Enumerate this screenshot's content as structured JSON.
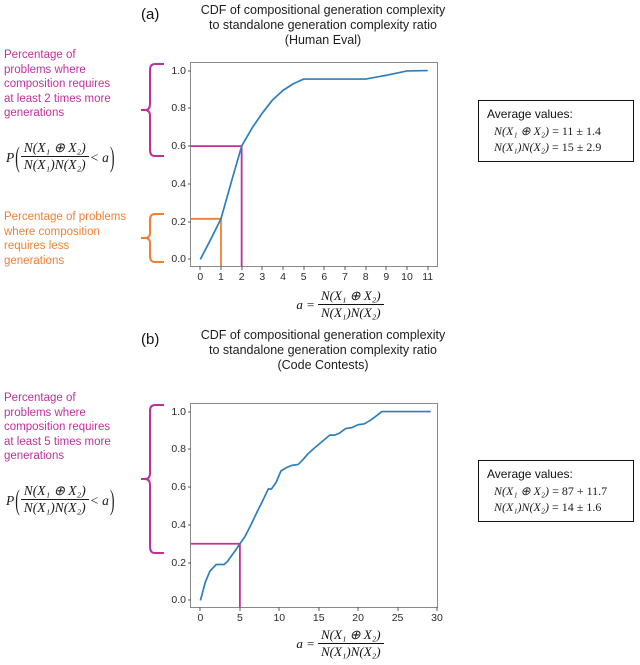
{
  "figure": {
    "panels": [
      {
        "letter": "(a)",
        "title_line1": "CDF of compositional generation complexity",
        "title_line2": "to standalone generation complexity ratio",
        "title_line3": "(Human Eval)"
      },
      {
        "letter": "(b)",
        "title_line1": "CDF of compositional generation complexity",
        "title_line2": "to standalone generation complexity ratio",
        "title_line3": "(Code Contests)"
      }
    ]
  },
  "annotations": {
    "a_purple": {
      "text": "Percentage of problems where composition requires at least 2 times more generations",
      "lines": [
        "Percentage of",
        "problems where",
        "composition requires",
        "at least 2 times more",
        "generations"
      ],
      "color": "#c0309c",
      "span_from": 0.6,
      "span_to": 1.0
    },
    "a_orange": {
      "text": "Percentage of problems where composition requires less generations",
      "lines": [
        "Percentage of problems",
        "where composition",
        "requires less",
        "generations"
      ],
      "color": "#f07f35",
      "span_from": 0.0,
      "span_to": 0.2
    },
    "b_purple": {
      "text": "Percentage of problems where composition requires at least 5 times more generations",
      "lines": [
        "Percentage of",
        "problems where",
        "composition requires",
        "at least 5 times more",
        "generations"
      ],
      "color": "#c0309c",
      "span_from": 0.3,
      "span_to": 1.0
    },
    "probability_formula": {
      "p": "P",
      "numerator": "N(X₁ ⊕ X₂)",
      "denominator": "N(X₁)N(X₂)",
      "comparison": "< a"
    },
    "axis_formula": {
      "lhs": "a =",
      "numerator": "N(X₁ ⊕ X₂)",
      "denominator": "N(X₁)N(X₂)"
    }
  },
  "info_boxes": [
    {
      "title": "Average values:",
      "rows": [
        {
          "label": "N(X₁ ⊕ X₂)",
          "value": "= 11 ± 1.4"
        },
        {
          "label": "N(X₁)N(X₂)",
          "value": "= 15 ± 2.9"
        }
      ]
    },
    {
      "title": "Average values:",
      "rows": [
        {
          "label": "N(X₁ ⊕ X₂)",
          "value": "= 87 + 11.7"
        },
        {
          "label": "N(X₁)N(X₂)",
          "value": "= 14 ± 1.6"
        }
      ]
    }
  ],
  "colors": {
    "curve": "#2e7ebb",
    "purple": "#c0309c",
    "orange": "#f07f35",
    "axis": "#8a8a8a",
    "text": "#1a1a1a"
  },
  "chart_data": [
    {
      "type": "line",
      "title": "CDF of compositional generation complexity to standalone generation complexity ratio (Human Eval)",
      "subtitle": "(Human Eval)",
      "xlabel": "a = N(X1 (+) X2) / N(X1)N(X2)",
      "ylabel": "",
      "xlim": [
        -0.45,
        11.45
      ],
      "ylim": [
        -0.035,
        1.04
      ],
      "xticks": [
        0,
        1,
        2,
        3,
        4,
        5,
        6,
        7,
        8,
        9,
        10,
        11
      ],
      "yticks": [
        0.0,
        0.2,
        0.4,
        0.6,
        0.8,
        1.0
      ],
      "grid": false,
      "legend": "none",
      "series": [
        {
          "name": "CDF",
          "color": "#2e7ebb",
          "x": [
            0,
            0.5,
            1,
            1.5,
            2,
            2.5,
            3,
            3.5,
            4,
            4.5,
            5,
            6,
            7,
            8,
            9,
            10,
            11
          ],
          "y": [
            0.0,
            0.105,
            0.215,
            0.41,
            0.6,
            0.695,
            0.775,
            0.845,
            0.895,
            0.93,
            0.955,
            0.955,
            0.955,
            0.955,
            0.975,
            0.998,
            1.0
          ]
        }
      ],
      "guides": [
        {
          "name": "purple-guide",
          "color": "#c0309c",
          "x": 2,
          "y": 0.6
        },
        {
          "name": "orange-guide",
          "color": "#f07f35",
          "x": 1,
          "y": 0.215
        }
      ]
    },
    {
      "type": "line",
      "title": "CDF of compositional generation complexity to standalone generation complexity ratio (Code Contests)",
      "subtitle": "(Code Contests)",
      "xlabel": "a = N(X1 (+) X2) / N(X1)N(X2)",
      "ylabel": "",
      "xlim": [
        -1.2,
        30
      ],
      "ylim": [
        -0.035,
        1.04
      ],
      "xticks": [
        0,
        5,
        10,
        15,
        20,
        25,
        30
      ],
      "yticks": [
        0.0,
        0.2,
        0.4,
        0.6,
        0.8,
        1.0
      ],
      "grid": false,
      "legend": "none",
      "series": [
        {
          "name": "CDF",
          "color": "#2e7ebb",
          "x": [
            0,
            0.6,
            1.2,
            2,
            2.4,
            3,
            3.4,
            4,
            4.6,
            5,
            5.6,
            6.4,
            7.2,
            7.8,
            8.6,
            9,
            9.6,
            10.2,
            11,
            11.6,
            12.4,
            13,
            13.6,
            14.4,
            15.4,
            16.4,
            17,
            17.6,
            18.4,
            19.2,
            20,
            20.8,
            21.6,
            22.4,
            23,
            25,
            27,
            29.2
          ],
          "y": [
            0.0,
            0.095,
            0.155,
            0.19,
            0.19,
            0.19,
            0.205,
            0.24,
            0.275,
            0.3,
            0.335,
            0.4,
            0.47,
            0.52,
            0.59,
            0.59,
            0.625,
            0.685,
            0.705,
            0.715,
            0.72,
            0.745,
            0.775,
            0.805,
            0.84,
            0.875,
            0.875,
            0.885,
            0.91,
            0.915,
            0.93,
            0.935,
            0.955,
            0.98,
            1.0,
            1.0,
            1.0,
            1.0
          ]
        }
      ],
      "guides": [
        {
          "name": "purple-guide",
          "color": "#c0309c",
          "x": 5,
          "y": 0.3
        }
      ]
    }
  ]
}
